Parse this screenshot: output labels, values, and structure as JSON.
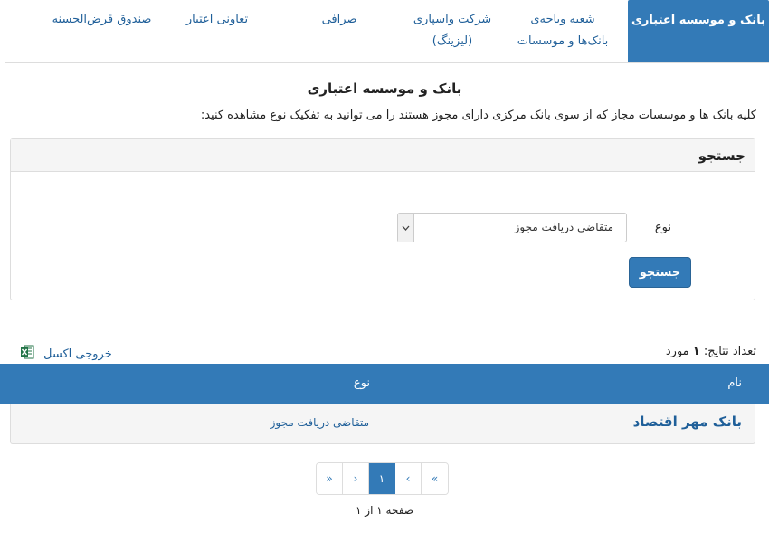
{
  "tabs": [
    {
      "line1": "بانک و موسسه اعتباری",
      "line2": ""
    },
    {
      "line1": "شعبه وباجه‌ی",
      "line2": "بانک‌ها و موسسات"
    },
    {
      "line1": "شرکت واسپاری",
      "line2": "(لیزینگ)"
    },
    {
      "line1": "صرافی",
      "line2": ""
    },
    {
      "line1": "تعاونی اعتبار",
      "line2": ""
    },
    {
      "line1": "صندوق قرض‌الحسنه",
      "line2": ""
    }
  ],
  "page": {
    "title": "بانک و موسسه اعتباری",
    "description": "کلیه بانک ها و موسسات مجاز که از سوی بانک مرکزی دارای مجوز هستند را می توانید به تفکیک نوع مشاهده کنید:"
  },
  "search": {
    "header": "جستجو",
    "type_label": "نوع",
    "type_value": "متقاضی دریافت مجوز",
    "button_label": "جستجو"
  },
  "results": {
    "count_label": "تعداد نتایج:",
    "count_value": "۱",
    "count_unit": "مورد",
    "excel_label": "خروجی اکسل",
    "columns": {
      "name": "نام",
      "type": "نوع"
    },
    "rows": [
      {
        "name": "بانک مهر اقتصاد",
        "type": "متقاضی دریافت مجوز"
      }
    ]
  },
  "pagination": {
    "first": "«",
    "prev": "‹",
    "current": "۱",
    "next": "›",
    "last": "»",
    "info": "صفحه ۱ از ۱"
  },
  "colors": {
    "primary": "#337ab7",
    "link": "#1f5f99",
    "panel_bg": "#f5f5f5"
  }
}
